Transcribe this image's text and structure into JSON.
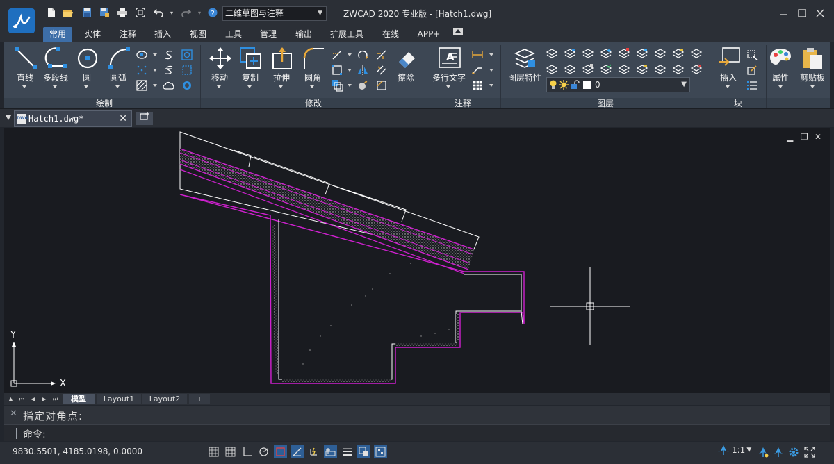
{
  "app": {
    "window_title": "ZWCAD 2020 专业版 - [Hatch1.dwg]",
    "workspace": "二维草图与注释"
  },
  "ribbon": {
    "tabs": [
      "常用",
      "实体",
      "注释",
      "插入",
      "视图",
      "工具",
      "管理",
      "输出",
      "扩展工具",
      "在线",
      "APP+"
    ],
    "active_tab": "常用",
    "panels": {
      "draw": {
        "label": "绘制",
        "tools": [
          "直线",
          "多段线",
          "圆",
          "圆弧"
        ]
      },
      "modify": {
        "label": "修改",
        "tools": [
          "移动",
          "复制",
          "拉伸",
          "圆角",
          "擦除"
        ]
      },
      "annotation": {
        "label": "注释",
        "tools": [
          "多行文字"
        ]
      },
      "layers": {
        "label": "图层",
        "tools": [
          "图层特性"
        ],
        "current_layer": "0"
      },
      "block": {
        "label": "块",
        "tools": [
          "插入"
        ]
      },
      "right": {
        "tools": [
          "属性",
          "剪贴板"
        ]
      }
    }
  },
  "document": {
    "tab_name": "Hatch1.dwg*",
    "dwg_badge": "DWG"
  },
  "canvas": {
    "axis_x": "X",
    "axis_y": "Y"
  },
  "layout_tabs": [
    "模型",
    "Layout1",
    "Layout2"
  ],
  "layout_add": "+",
  "command": {
    "history": "指定对角点:",
    "prompt": "命令:"
  },
  "status": {
    "coordinates": "9830.5501, 4185.0198, 0.0000",
    "scale": "1:1"
  },
  "colors": {
    "accent": "#3d6ea8",
    "hatch_magenta": "#d020d0",
    "drawing_white": "#ffffff",
    "canvas_bg": "#191b20"
  }
}
